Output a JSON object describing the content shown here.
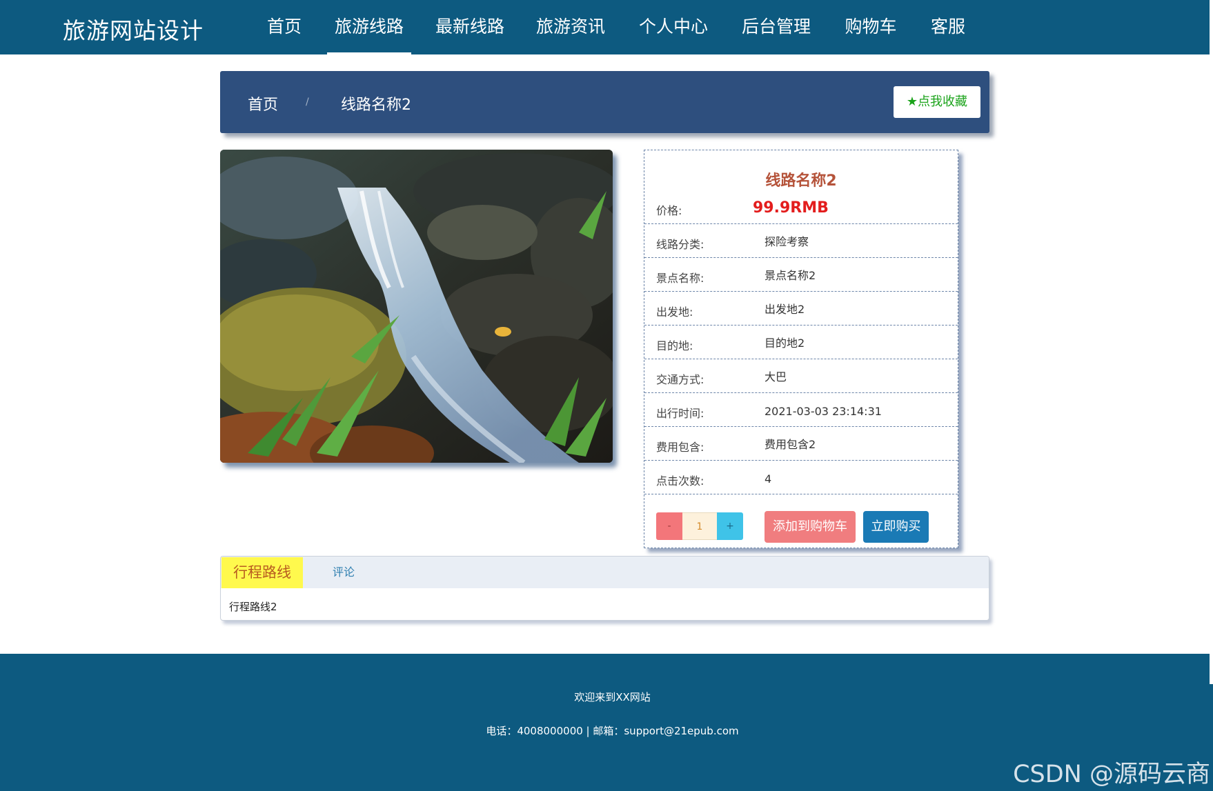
{
  "brand": "旅游网站设计",
  "nav": {
    "items": [
      {
        "label": "首页",
        "active": false
      },
      {
        "label": "旅游线路",
        "active": true
      },
      {
        "label": "最新线路",
        "active": false
      },
      {
        "label": "旅游资讯",
        "active": false
      },
      {
        "label": "个人中心",
        "active": false
      },
      {
        "label": "后台管理",
        "active": false
      },
      {
        "label": "购物车",
        "active": false
      },
      {
        "label": "客服",
        "active": false
      }
    ]
  },
  "breadcrumb": {
    "home": "首页",
    "separator": "/",
    "current": "线路名称2"
  },
  "favorite_button": "点我收藏",
  "photo_icon": "waterfall-photo",
  "detail": {
    "title": "线路名称2",
    "price_label": "价格:",
    "price_value": "99.9RMB",
    "rows": [
      {
        "label": "线路分类:",
        "value": "探险考察"
      },
      {
        "label": "景点名称:",
        "value": "景点名称2"
      },
      {
        "label": "出发地:",
        "value": "出发地2"
      },
      {
        "label": "目的地:",
        "value": "目的地2"
      },
      {
        "label": "交通方式:",
        "value": "大巴"
      },
      {
        "label": "出行时间:",
        "value": "2021-03-03 23:14:31"
      },
      {
        "label": "费用包含:",
        "value": "费用包含2"
      },
      {
        "label": "点击次数:",
        "value": "4"
      }
    ],
    "quantity": {
      "minus": "-",
      "value": "1",
      "plus": "+"
    },
    "add_to_cart": "添加到购物车",
    "buy_now": "立即购买"
  },
  "tabs": {
    "items": [
      {
        "label": "行程路线",
        "active": true
      },
      {
        "label": "评论",
        "active": false
      }
    ],
    "content": "行程路线2"
  },
  "footer": {
    "welcome": "欢迎来到XX网站",
    "contact": "电话：4008000000 | 邮箱：support@21epub.com"
  },
  "watermark": "CSDN @源码云商",
  "colors": {
    "header_bg": "#0d5a80",
    "breadcrumb_bg": "#2e4f7e",
    "price": "#e31d1d",
    "title": "#b5533a",
    "cart_button": "#f07d7f",
    "buy_button": "#1a7ab5",
    "active_tab": "#fff94d"
  }
}
